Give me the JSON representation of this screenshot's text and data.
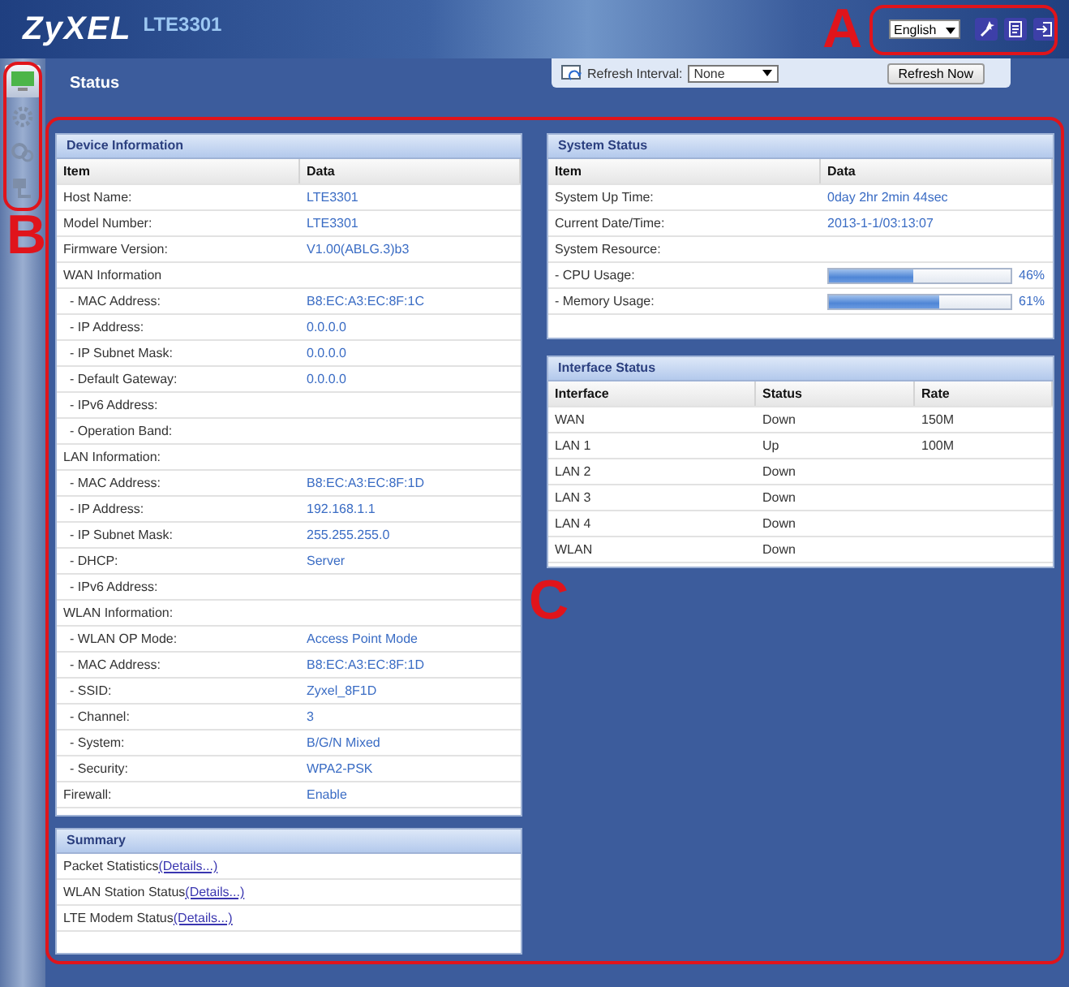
{
  "header": {
    "logo": "ZyXEL",
    "model": "LTE3301",
    "language": "English"
  },
  "sidebar": {
    "items": [
      {
        "selected": true
      },
      {
        "selected": false
      },
      {
        "selected": false
      },
      {
        "selected": false
      }
    ]
  },
  "status_bar": {
    "title": "Status",
    "refresh_label": "Refresh Interval:",
    "refresh_value": "None",
    "button": "Refresh Now"
  },
  "device_information": {
    "title": "Device Information",
    "columns": [
      "Item",
      "Data"
    ],
    "rows": [
      {
        "item": "Host Name:",
        "data": "LTE3301"
      },
      {
        "item": "Model Number:",
        "data": "LTE3301"
      },
      {
        "item": "Firmware Version:",
        "data": "V1.00(ABLG.3)b3"
      },
      {
        "item": "WAN Information",
        "children": [
          {
            "item": "- MAC Address:",
            "data": "B8:EC:A3:EC:8F:1C"
          },
          {
            "item": "- IP Address:",
            "data": "0.0.0.0"
          },
          {
            "item": "- IP Subnet Mask:",
            "data": "0.0.0.0"
          },
          {
            "item": "- Default Gateway:",
            "data": "0.0.0.0"
          },
          {
            "item": "- IPv6 Address:"
          },
          {
            "item": "- Operation Band:"
          }
        ]
      },
      {
        "item": "LAN Information:",
        "children": [
          {
            "item": "- MAC Address:",
            "data": "B8:EC:A3:EC:8F:1D"
          },
          {
            "item": "- IP Address:",
            "data": "192.168.1.1"
          },
          {
            "item": "- IP Subnet Mask:",
            "data": "255.255.255.0"
          },
          {
            "item": "- DHCP:",
            "data": "Server"
          },
          {
            "item": "- IPv6 Address:"
          }
        ]
      },
      {
        "item": "WLAN Information:",
        "children": [
          {
            "item": "- WLAN OP Mode:",
            "data": "Access Point Mode"
          },
          {
            "item": "- MAC Address:",
            "data": "B8:EC:A3:EC:8F:1D"
          },
          {
            "item": "- SSID:",
            "data": "Zyxel_8F1D"
          },
          {
            "item": "- Channel:",
            "data": "3"
          },
          {
            "item": "- System:",
            "data": "B/G/N Mixed"
          },
          {
            "item": "- Security:",
            "data": "WPA2-PSK"
          }
        ]
      },
      {
        "item": "Firewall:",
        "data": "Enable"
      }
    ]
  },
  "summary": {
    "title": "Summary",
    "rows": [
      {
        "label": "Packet Statistics",
        "link": "(Details...)"
      },
      {
        "label": "WLAN Station Status",
        "link": "(Details...)"
      },
      {
        "label": "LTE Modem Status",
        "link": "(Details...)"
      }
    ]
  },
  "system_status": {
    "title": "System Status",
    "columns": [
      "Item",
      "Data"
    ],
    "rows": [
      {
        "kind": "text",
        "item": "System Up Time:",
        "data": "0day 2hr 2min 44sec"
      },
      {
        "kind": "text",
        "item": "Current Date/Time:",
        "data": "2013-1-1/03:13:07"
      },
      {
        "kind": "text",
        "item": "System Resource:"
      },
      {
        "kind": "meter",
        "item": "- CPU Usage:",
        "level": 0.46,
        "reading": "46%"
      },
      {
        "kind": "meter",
        "item": "- Memory Usage:",
        "level": 0.61,
        "reading": "61%"
      }
    ]
  },
  "interface_status": {
    "title": "Interface Status",
    "columns": [
      "Interface",
      "Status",
      "Rate"
    ],
    "rows": [
      {
        "interface": "WAN",
        "status": "Down",
        "rate": "150M"
      },
      {
        "interface": "LAN 1",
        "status": "Up",
        "rate": "100M"
      },
      {
        "interface": "LAN 2",
        "status": "Down"
      },
      {
        "interface": "LAN 3",
        "status": "Down"
      },
      {
        "interface": "LAN 4",
        "status": "Down"
      },
      {
        "interface": "WLAN",
        "status": "Down"
      }
    ]
  },
  "callouts": [
    {
      "label": "A"
    },
    {
      "label": "B"
    },
    {
      "label": "C"
    }
  ]
}
